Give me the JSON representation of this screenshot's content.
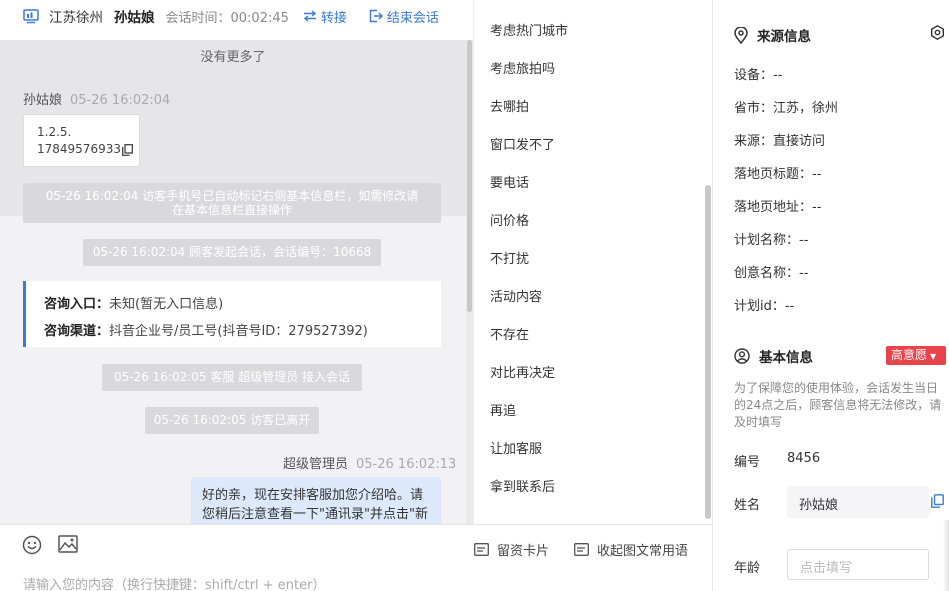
{
  "header": {
    "city": "江苏徐州",
    "visitor_name": "孙姑娘",
    "session_time": "会话时间：00:02:45",
    "transfer_label": "转接",
    "end_label": "结束会话"
  },
  "chat": {
    "no_more": "没有更多了",
    "visitor_sender": "孙姑娘",
    "visitor_time": "05-26 16:02:04",
    "visitor_msg_line1": "1.2.5.",
    "visitor_msg_line2": "17849576933",
    "sys1_line1": "05-26 16:02:04 访客手机号已自动标记右侧基本信息栏，如需修改请",
    "sys1_line2": "在基本信息栏直接操作",
    "sys2": "05-26 16:02:04 顾客发起会话，会话编号：10668",
    "consult_entry_label": "咨询入口：",
    "consult_entry_value": "未知(暂无入口信息)",
    "consult_channel_label": "咨询渠道：",
    "consult_channel_value": "抖音企业号/员工号(抖音号ID：279527392)",
    "sys3": "05-26 16:02:05 客服 超级管理员 接入会话",
    "sys4": "05-26 16:02:05 访客已离开",
    "agent_sender": "超级管理员",
    "agent_time": "05-26 16:02:13",
    "agent_msg": "好的亲，现在安排客服加您介绍哈。请您稍后注意查看一下\"通讯录\"并点击\"新的朋友\"通过下"
  },
  "input": {
    "placeholder": "请输入您的内容（换行快捷键：shift/ctrl + enter）",
    "card_label": "留资卡片",
    "phrases_label": "收起图文常用语"
  },
  "phrases": [
    "考虑热门城市",
    "考虑旅拍吗",
    "去哪拍",
    "窗口发不了",
    "要电话",
    "问价格",
    "不打扰",
    "活动内容",
    "不存在",
    "对比再决定",
    "再追",
    "让加客服",
    "拿到联系后"
  ],
  "source_info": {
    "title": "来源信息",
    "device": "设备：--",
    "province": "省市：江苏，徐州",
    "source": "来源：直接访问",
    "landing_title": "落地页标题：--",
    "landing_url": "落地页地址：--",
    "plan_name": "计划名称：--",
    "creative_name": "创意名称：--",
    "plan_id": "计划id：--"
  },
  "basic_info": {
    "title": "基本信息",
    "intent_badge": "高意愿",
    "note": "为了保障您的使用体验，会话发生当日的24点之后，顾客信息将无法修改，请及时填写",
    "id_label": "编号",
    "id_value": "8456",
    "name_label": "姓名",
    "name_value": "孙姑娘",
    "age_label": "年龄",
    "age_placeholder": "点击填写"
  },
  "colors": {
    "accent": "#3a7bd5",
    "badge": "#e9434b",
    "system_msg_bg": "#d9d9db",
    "agent_bubble_bg": "#dde9fb"
  }
}
